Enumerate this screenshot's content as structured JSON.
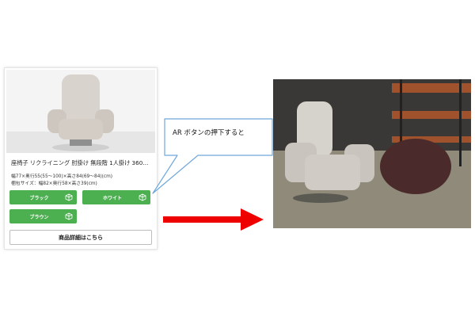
{
  "product": {
    "title": "座椅子 リクライニング 肘掛け 無段階 1人掛け 360…",
    "spec_line1": "幅77×奥行55(55〜100)×高さ84(69〜84)(cm)",
    "spec_line2": "梱包サイズ：幅82×奥行58×高さ39(cm)",
    "color_buttons": [
      {
        "label": "ブラック",
        "icon": "ar-cube-icon"
      },
      {
        "label": "ホワイト",
        "icon": "ar-cube-icon"
      },
      {
        "label": "ブラウン",
        "icon": "ar-cube-icon"
      }
    ],
    "detail_button": "商品詳細はこちら"
  },
  "callout": {
    "text": "AR ボタンの押下すると"
  },
  "colors": {
    "button_green": "#4caf50",
    "arrow_red": "#ee0000"
  }
}
